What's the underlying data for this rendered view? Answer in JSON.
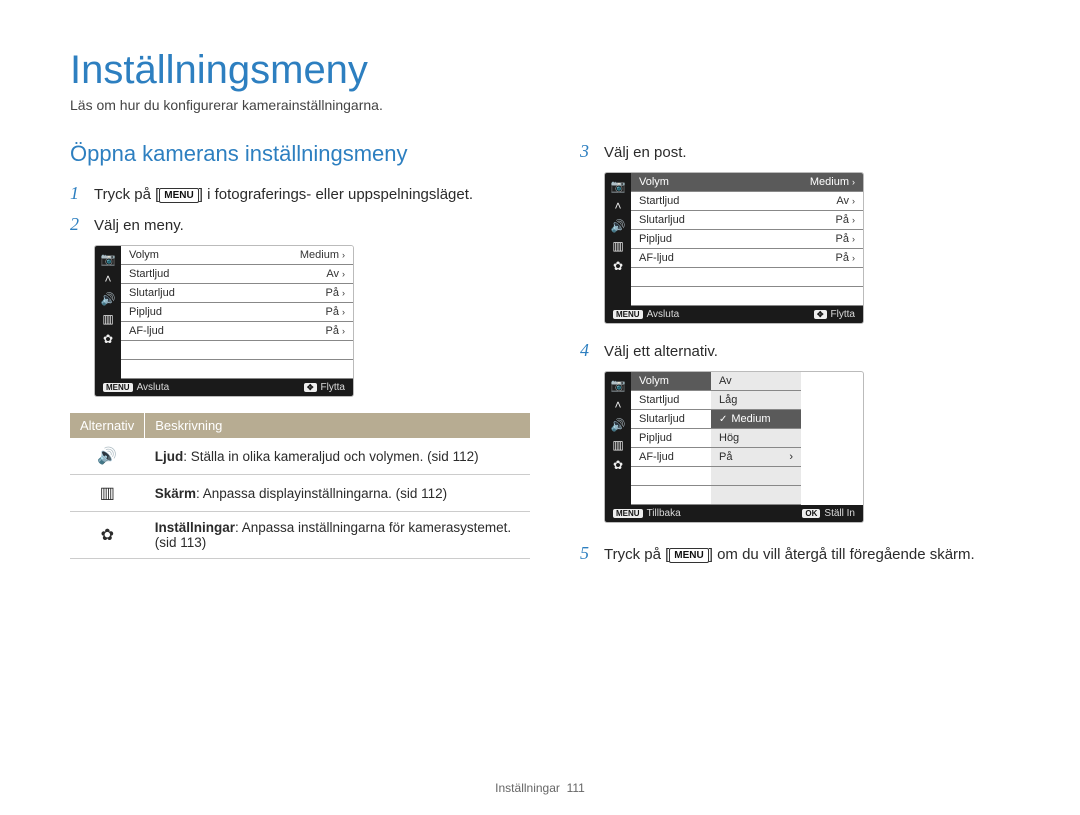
{
  "title": "Inställningsmeny",
  "subtitle": "Läs om hur du konfigurerar kamerainställningarna.",
  "heading": "Öppna kamerans inställningsmeny",
  "menu_btn": "MENU",
  "steps": {
    "s1a": "Tryck på [",
    "s1b": "] i fotograferings- eller uppspelningsläget.",
    "s2": "Välj en meny.",
    "s3": "Välj en post.",
    "s4": "Välj ett alternativ.",
    "s5a": "Tryck på [",
    "s5b": "] om du vill återgå till föregående skärm."
  },
  "lcd1": {
    "rows": [
      {
        "label": "Volym",
        "value": "Medium"
      },
      {
        "label": "Startljud",
        "value": "Av"
      },
      {
        "label": "Slutarljud",
        "value": "På"
      },
      {
        "label": "Pipljud",
        "value": "På"
      },
      {
        "label": "AF-ljud",
        "value": "På"
      }
    ],
    "foot_left_badge": "MENU",
    "foot_left": "Avsluta",
    "foot_right_badge": "✥",
    "foot_right": "Flytta"
  },
  "lcd2": {
    "rows": [
      {
        "label": "Volym",
        "value": "Medium"
      },
      {
        "label": "Startljud",
        "value": "Av"
      },
      {
        "label": "Slutarljud",
        "value": "På"
      },
      {
        "label": "Pipljud",
        "value": "På"
      },
      {
        "label": "AF-ljud",
        "value": "På"
      }
    ],
    "foot_left_badge": "MENU",
    "foot_left": "Avsluta",
    "foot_right_badge": "✥",
    "foot_right": "Flytta"
  },
  "lcd3": {
    "left_rows": [
      "Volym",
      "Startljud",
      "Slutarljud",
      "Pipljud",
      "AF-ljud"
    ],
    "right_rows": [
      {
        "label": "Av",
        "sel": false,
        "check": false
      },
      {
        "label": "Låg",
        "sel": false,
        "check": false
      },
      {
        "label": "Medium",
        "sel": true,
        "check": true
      },
      {
        "label": "Hög",
        "sel": false,
        "check": false
      },
      {
        "label": "På",
        "sel": false,
        "check": false,
        "arr": true
      }
    ],
    "foot_left_badge": "MENU",
    "foot_left": "Tillbaka",
    "foot_right_badge": "OK",
    "foot_right": "Ställ In"
  },
  "alt_table": {
    "th1": "Alternativ",
    "th2": "Beskrivning",
    "rows": [
      {
        "icon": "🔊",
        "bold": "Ljud",
        "text": ": Ställa in olika kameraljud och volymen. (sid 112)"
      },
      {
        "icon": "▥",
        "bold": "Skärm",
        "text": ": Anpassa displayinställningarna. (sid 112)"
      },
      {
        "icon": "✿",
        "bold": "Inställningar",
        "text": ": Anpassa inställningarna för kamerasystemet. (sid 113)"
      }
    ]
  },
  "footer": {
    "section": "Inställningar",
    "page": "111"
  }
}
